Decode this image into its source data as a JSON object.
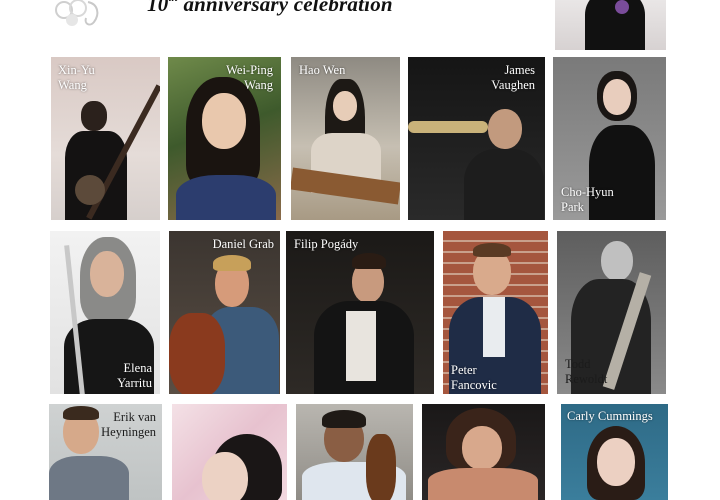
{
  "header": {
    "ordinal_number": "10",
    "ordinal_suffix": "th",
    "title_rest": "anniversary celebration"
  },
  "row1": [
    {
      "id": "xin-yu-wang",
      "name_line1": "Xin-Yu",
      "name_line2": "Wang"
    },
    {
      "id": "wei-ping-wang",
      "name_line1": "Wei-Ping",
      "name_line2": "Wang"
    },
    {
      "id": "hao-wen",
      "name_line1": "Hao Wen",
      "name_line2": ""
    },
    {
      "id": "james-vaughen",
      "name_line1": "James",
      "name_line2": "Vaughen"
    },
    {
      "id": "cho-hyun-park",
      "name_line1": "Cho-Hyun",
      "name_line2": "Park"
    }
  ],
  "row2": [
    {
      "id": "elena-yarritu",
      "name_line1": "Elena",
      "name_line2": "Yarritu"
    },
    {
      "id": "daniel-grab",
      "name_line1": "Daniel Grab",
      "name_line2": ""
    },
    {
      "id": "filip-pogady",
      "name_line1": "Filip Pogády",
      "name_line2": ""
    },
    {
      "id": "peter-fancovic",
      "name_line1": "Peter",
      "name_line2": "Fancovic"
    },
    {
      "id": "todd-rewoldt",
      "name_line1": "Todd",
      "name_line2": "Rewoldt"
    }
  ],
  "row3": [
    {
      "id": "erik-van-heyningen",
      "name_line1": "Erik van",
      "name_line2": "Heyningen"
    },
    {
      "id": "carly-cummings",
      "name_line1": "Carly Cummings",
      "name_line2": ""
    }
  ]
}
